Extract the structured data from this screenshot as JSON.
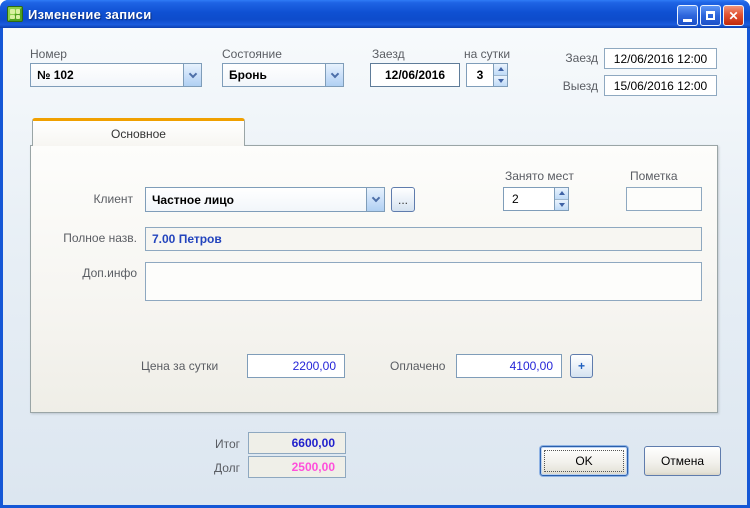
{
  "window": {
    "title": "Изменение записи"
  },
  "titlebar": {
    "close_glyph": "✕"
  },
  "top_row": {
    "room": {
      "label": "Номер",
      "value": "№ 102"
    },
    "state": {
      "label": "Состояние",
      "value": "Бронь"
    },
    "checkin_date": {
      "label": "Заезд",
      "value": "12/06/2016"
    },
    "nights": {
      "label": "на сутки",
      "value": "3"
    },
    "checkin_datetime": {
      "label": "Заезд",
      "value": "12/06/2016 12:00"
    },
    "checkout_datetime": {
      "label": "Выезд",
      "value": "15/06/2016 12:00"
    }
  },
  "tabs": {
    "main_label": "Основное"
  },
  "form": {
    "client": {
      "label": "Клиент",
      "value": "Частное лицо"
    },
    "browse_label": "...",
    "occupied": {
      "label": "Занято мест",
      "value": "2"
    },
    "note": {
      "label": "Пометка",
      "value": ""
    },
    "full_name": {
      "label": "Полное назв.",
      "value": "7.00 Петров"
    },
    "extra_info": {
      "label": "Доп.инфо",
      "value": ""
    },
    "price_per_day": {
      "label": "Цена за сутки",
      "value": "2200,00"
    },
    "paid": {
      "label": "Оплачено",
      "value": "4100,00"
    },
    "plus_label": "+"
  },
  "footer": {
    "total": {
      "label": "Итог",
      "value": "6600,00"
    },
    "debt": {
      "label": "Долг",
      "value": "2500,00"
    },
    "ok_label": "OK",
    "cancel_label": "Отмена"
  },
  "colors": {
    "title_blue": "#1557D6",
    "accent_orange": "#F0A000",
    "value_blue": "#2525D8",
    "total_blue": "#2121CC",
    "debt_pink": "#FF4FDB",
    "field_border": "#7F9DB9"
  }
}
